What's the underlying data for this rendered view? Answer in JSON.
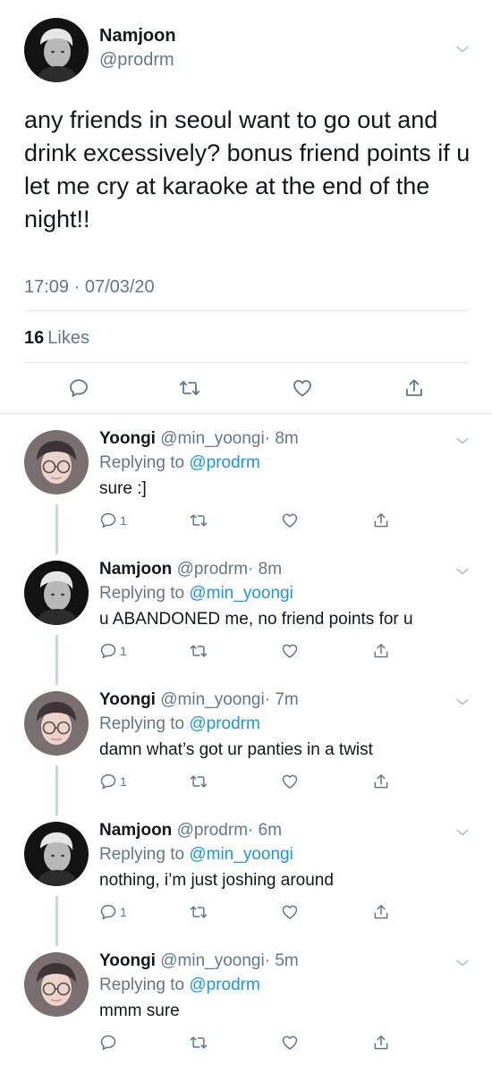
{
  "main_tweet": {
    "name": "Namjoon",
    "handle": "@prodrm",
    "text": "any friends in seoul want to go out and drink excessively? bonus friend points if u let me cry at karaoke at the end of the night!!",
    "timestamp": "17:09 · 07/03/20",
    "likes_count": "16",
    "likes_label": "Likes"
  },
  "replies": [
    {
      "name": "Yoongi",
      "handle": "@min_yoongi",
      "time": "· 8m",
      "replying_label": "Replying to",
      "replying_to": "@prodrm",
      "text": "sure :]",
      "reply_count": "1"
    },
    {
      "name": "Namjoon",
      "handle": "@prodrm",
      "time": "· 8m",
      "replying_label": "Replying to",
      "replying_to": "@min_yoongi",
      "text": "u ABANDONED me, no friend points for u",
      "reply_count": "1"
    },
    {
      "name": "Yoongi",
      "handle": "@min_yoongi",
      "time": "· 7m",
      "replying_label": "Replying to",
      "replying_to": "@prodrm",
      "text": "damn what’s got ur panties in a twist",
      "reply_count": "1"
    },
    {
      "name": "Namjoon",
      "handle": "@prodrm",
      "time": "· 6m",
      "replying_label": "Replying to",
      "replying_to": "@min_yoongi",
      "text": "nothing, i’m just joshing around",
      "reply_count": "1"
    },
    {
      "name": "Yoongi",
      "handle": "@min_yoongi",
      "time": "· 5m",
      "replying_label": "Replying to",
      "replying_to": "@prodrm",
      "text": "mmm sure",
      "reply_count": ""
    }
  ],
  "colors": {
    "text_primary": "#14171a",
    "text_secondary": "#657786",
    "link": "#1b95e0",
    "divider": "#e1e8ed",
    "thread_line": "#ccd6dd"
  },
  "icons": [
    "chevron-down-icon",
    "reply-icon",
    "retweet-icon",
    "like-icon",
    "share-icon"
  ]
}
